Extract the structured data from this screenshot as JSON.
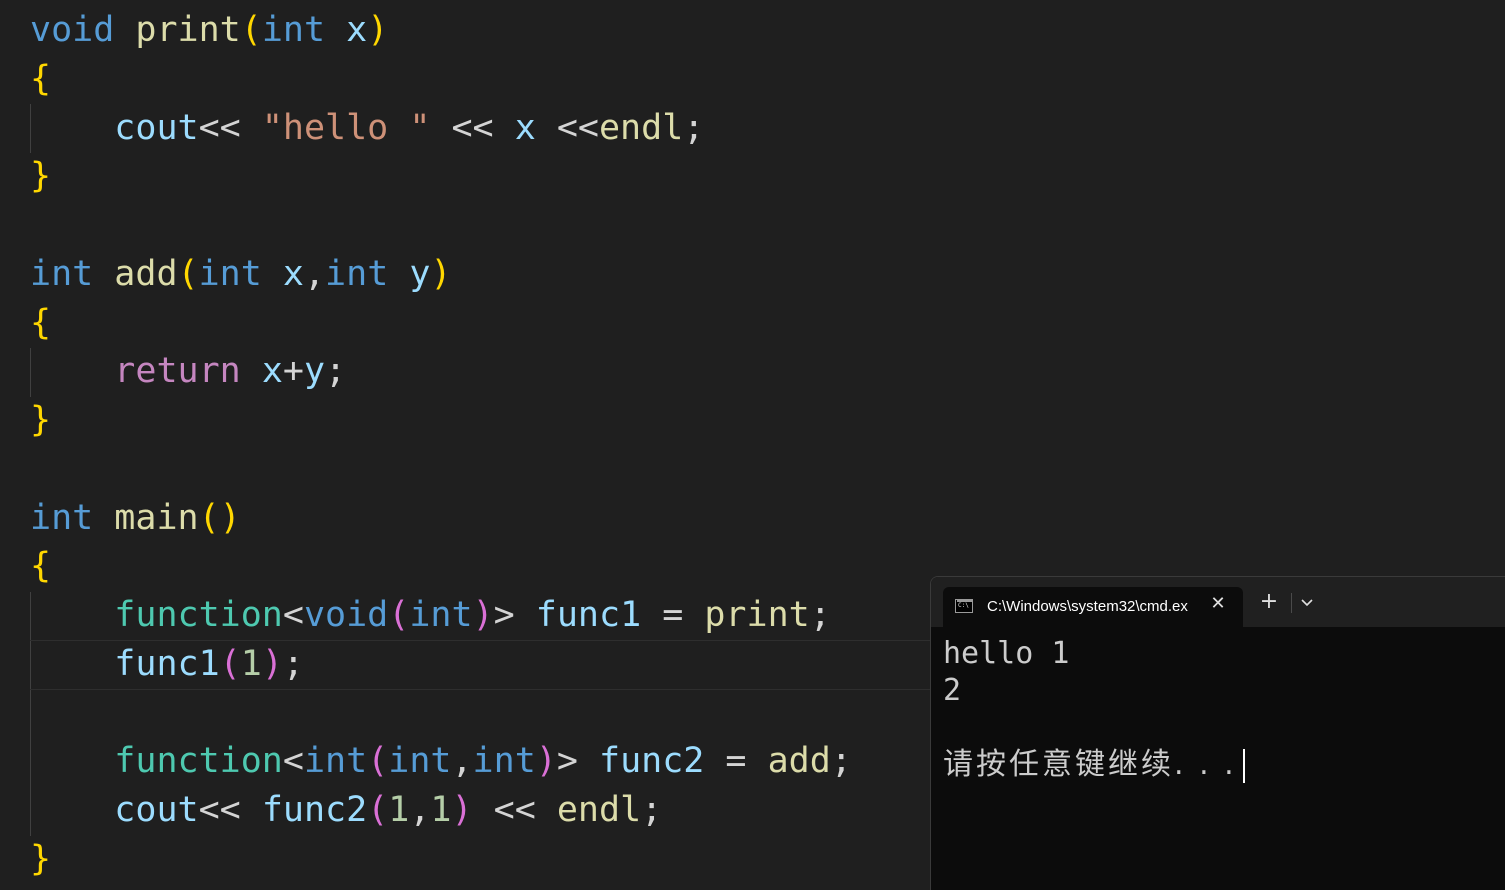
{
  "editor": {
    "language": "C++",
    "lines": [
      [
        {
          "t": "void",
          "c": "kw"
        },
        {
          "t": " "
        },
        {
          "t": "print",
          "c": "fn"
        },
        {
          "t": "(",
          "c": "b1"
        },
        {
          "t": "int",
          "c": "kw"
        },
        {
          "t": " "
        },
        {
          "t": "x",
          "c": "var"
        },
        {
          "t": ")",
          "c": "b1"
        }
      ],
      [
        {
          "t": "{",
          "c": "b1"
        }
      ],
      [
        {
          "t": "    "
        },
        {
          "t": "cout",
          "c": "var"
        },
        {
          "t": "<< ",
          "c": "op"
        },
        {
          "t": "\"hello \"",
          "c": "str"
        },
        {
          "t": " << ",
          "c": "op"
        },
        {
          "t": "x",
          "c": "var"
        },
        {
          "t": " <<",
          "c": "op"
        },
        {
          "t": "endl",
          "c": "fn"
        },
        {
          "t": ";",
          "c": "op"
        }
      ],
      [
        {
          "t": "}",
          "c": "b1"
        }
      ],
      [],
      [
        {
          "t": "int",
          "c": "kw"
        },
        {
          "t": " "
        },
        {
          "t": "add",
          "c": "fn"
        },
        {
          "t": "(",
          "c": "b1"
        },
        {
          "t": "int",
          "c": "kw"
        },
        {
          "t": " "
        },
        {
          "t": "x",
          "c": "var"
        },
        {
          "t": ",",
          "c": "op"
        },
        {
          "t": "int",
          "c": "kw"
        },
        {
          "t": " "
        },
        {
          "t": "y",
          "c": "var"
        },
        {
          "t": ")",
          "c": "b1"
        }
      ],
      [
        {
          "t": "{",
          "c": "b1"
        }
      ],
      [
        {
          "t": "    "
        },
        {
          "t": "return",
          "c": "ctl"
        },
        {
          "t": " "
        },
        {
          "t": "x",
          "c": "var"
        },
        {
          "t": "+",
          "c": "op"
        },
        {
          "t": "y",
          "c": "var"
        },
        {
          "t": ";",
          "c": "op"
        }
      ],
      [
        {
          "t": "}",
          "c": "b1"
        }
      ],
      [],
      [
        {
          "t": "int",
          "c": "kw"
        },
        {
          "t": " "
        },
        {
          "t": "main",
          "c": "fn"
        },
        {
          "t": "()",
          "c": "b1"
        }
      ],
      [
        {
          "t": "{",
          "c": "b1"
        }
      ],
      [
        {
          "t": "    "
        },
        {
          "t": "function",
          "c": "ty"
        },
        {
          "t": "<",
          "c": "op"
        },
        {
          "t": "void",
          "c": "kw"
        },
        {
          "t": "(",
          "c": "b2"
        },
        {
          "t": "int",
          "c": "kw"
        },
        {
          "t": ")",
          "c": "b2"
        },
        {
          "t": "> ",
          "c": "op"
        },
        {
          "t": "func1",
          "c": "var"
        },
        {
          "t": " = ",
          "c": "op"
        },
        {
          "t": "print",
          "c": "fn"
        },
        {
          "t": ";",
          "c": "op"
        }
      ],
      [
        {
          "t": "    "
        },
        {
          "t": "func1",
          "c": "var"
        },
        {
          "t": "(",
          "c": "b2"
        },
        {
          "t": "1",
          "c": "num"
        },
        {
          "t": ")",
          "c": "b2"
        },
        {
          "t": ";",
          "c": "op"
        }
      ],
      [],
      [
        {
          "t": "    "
        },
        {
          "t": "function",
          "c": "ty"
        },
        {
          "t": "<",
          "c": "op"
        },
        {
          "t": "int",
          "c": "kw"
        },
        {
          "t": "(",
          "c": "b2"
        },
        {
          "t": "int",
          "c": "kw"
        },
        {
          "t": ",",
          "c": "op"
        },
        {
          "t": "int",
          "c": "kw"
        },
        {
          "t": ")",
          "c": "b2"
        },
        {
          "t": "> ",
          "c": "op"
        },
        {
          "t": "func2",
          "c": "var"
        },
        {
          "t": " = ",
          "c": "op"
        },
        {
          "t": "add",
          "c": "fn"
        },
        {
          "t": ";",
          "c": "op"
        }
      ],
      [
        {
          "t": "    "
        },
        {
          "t": "cout",
          "c": "var"
        },
        {
          "t": "<< ",
          "c": "op"
        },
        {
          "t": "func2",
          "c": "var"
        },
        {
          "t": "(",
          "c": "b2"
        },
        {
          "t": "1",
          "c": "num"
        },
        {
          "t": ",",
          "c": "op"
        },
        {
          "t": "1",
          "c": "num"
        },
        {
          "t": ")",
          "c": "b2"
        },
        {
          "t": " << ",
          "c": "op"
        },
        {
          "t": "endl",
          "c": "fn"
        },
        {
          "t": ";",
          "c": "op"
        }
      ],
      [
        {
          "t": "}",
          "c": "b1"
        }
      ]
    ]
  },
  "terminal": {
    "tab_title": "C:\\Windows\\system32\\cmd.ex",
    "tab_icon": "console-icon",
    "icon_glyph": "C:\\",
    "close_icon": "close-icon",
    "close_glyph": "✕",
    "new_tab_icon": "plus-icon",
    "new_tab_glyph": "+",
    "dropdown_icon": "chevron-down-icon",
    "output": [
      "hello 1",
      "2",
      ""
    ],
    "prompt": "请按任意键继续. . ."
  },
  "colors": {
    "editor_bg": "#1f1f1f",
    "keyword": "#569cd6",
    "function": "#dcdcaa",
    "variable": "#9cdcfe",
    "type": "#4ec9b0",
    "string": "#ce9178",
    "number": "#b5cea8",
    "control": "#c586c0",
    "bracket_level1": "#ffd700",
    "bracket_level2": "#da70d6",
    "terminal_bg": "#0c0c0c"
  }
}
